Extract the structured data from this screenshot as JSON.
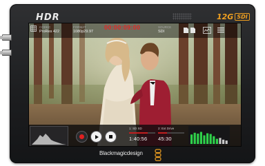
{
  "device": {
    "logo_text": "HDR",
    "badge_number": "12G",
    "badge_suffix": "SDI",
    "brand": "Blackmagicdesign"
  },
  "topbar": {
    "codec_label": "CODEC",
    "codec_value": "ProRes 422",
    "resolution_label": "FORMAT",
    "resolution_value": "1080p29.97",
    "timecode": "00:00:09:00",
    "source_label": "SOURCE",
    "source_value": "SDI"
  },
  "transport": {
    "slot1_name": "1: SD SD",
    "slot1_time": "1:40:56",
    "slot1_fill": 0.7,
    "slot2_name": "2: Ext Drive",
    "slot2_time": "45:30",
    "slot2_fill": 0.35
  },
  "colors": {
    "accent": "#f0a020",
    "record": "#e02020",
    "timecode": "#e02828",
    "meter_green": "#2fd04a"
  },
  "icons": [
    "grid-icon",
    "sd-card-icon",
    "scope-icon",
    "menu-icon",
    "record-icon",
    "play-icon",
    "stop-icon",
    "histogram-icon",
    "audio-meter-icon",
    "bmd-logo-icon"
  ]
}
